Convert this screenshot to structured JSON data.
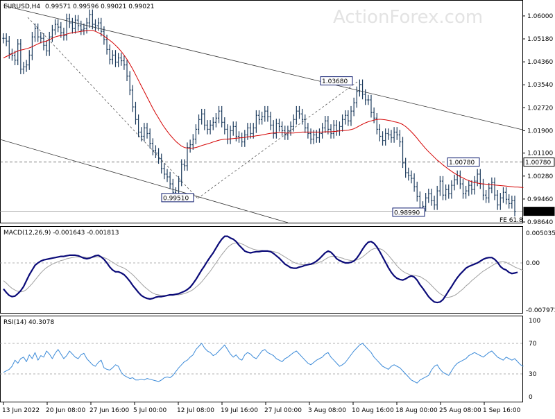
{
  "chart_data": [
    {
      "panel": "price",
      "type": "candlestick",
      "title": "EURUSD,H4",
      "ohlc_header": "0.99571 0.99596 0.99021 0.99021",
      "watermark": "ActionForex.com",
      "ylim": [
        0.9864,
        1.0642
      ],
      "yticks": [
        "1.06000",
        "1.05180",
        "1.04360",
        "1.03540",
        "1.02720",
        "1.01900",
        "1.01100",
        "1.00280",
        "0.99460",
        "0.98640"
      ],
      "price_tags": [
        {
          "label": "1.00780",
          "value": 1.0078
        },
        {
          "label": "0.99021",
          "value": 0.99021
        }
      ],
      "annotations": [
        {
          "text": "1.03680",
          "x": "10 Aug 2022 00:00",
          "y": 1.0368
        },
        {
          "text": "1.00780",
          "x": "26 Aug 2022 12:00",
          "y": 1.0078
        },
        {
          "text": "0.99510",
          "x": "14 Jul 2022 08:00",
          "y": 0.9951
        },
        {
          "text": "0.98990",
          "x": "23 Aug 2022 08:00",
          "y": 0.9899
        },
        {
          "text": "FE 61.8",
          "x": "5 Sep 2022 12:00",
          "y": 0.9872
        }
      ],
      "close": [
        1.052,
        1.051,
        1.0465,
        1.0458,
        1.0442,
        1.05,
        1.041,
        1.0418,
        1.0425,
        1.046,
        1.0525,
        1.0555,
        1.0525,
        1.052,
        1.0495,
        1.0475,
        1.0525,
        1.055,
        1.057,
        1.056,
        1.054,
        1.053,
        1.059,
        1.0575,
        1.0555,
        1.0585,
        1.0565,
        1.055,
        1.0555,
        1.0575,
        1.0605,
        1.057,
        1.0565,
        1.0575,
        1.0545,
        1.0515,
        1.048,
        1.0445,
        1.046,
        1.0435,
        1.045,
        1.044,
        1.0425,
        1.0385,
        1.0335,
        1.0275,
        1.023,
        1.0185,
        1.017,
        1.02,
        1.018,
        1.0145,
        1.012,
        1.011,
        1.009,
        1.0055,
        1.0035,
        1.0025,
        1.0,
        0.997,
        0.996,
        1.001,
        1.007,
        1.0065,
        1.013,
        1.014,
        1.016,
        1.0195,
        1.023,
        1.025,
        1.021,
        1.0195,
        1.021,
        1.022,
        1.0235,
        1.026,
        1.022,
        1.0195,
        1.016,
        1.019,
        1.0205,
        1.017,
        1.0165,
        1.015,
        1.0175,
        1.02,
        1.018,
        1.02,
        1.0245,
        1.023,
        1.024,
        1.026,
        1.024,
        1.021,
        1.018,
        1.0215,
        1.0205,
        1.019,
        1.0175,
        1.019,
        1.0205,
        1.023,
        1.026,
        1.025,
        1.023,
        1.02,
        1.018,
        1.016,
        1.0175,
        1.0165,
        1.018,
        1.02,
        1.0225,
        1.0195,
        1.018,
        1.021,
        1.019,
        1.0205,
        1.023,
        1.0245,
        1.0225,
        1.026,
        1.029,
        1.033,
        1.0355,
        1.032,
        1.03,
        1.03,
        1.0255,
        1.0235,
        1.0195,
        1.017,
        1.0155,
        1.018,
        1.0175,
        1.0165,
        1.0185,
        1.0175,
        1.015,
        1.0075,
        1.004,
        1.003,
        1.002,
        0.999,
        0.9955,
        0.991,
        0.992,
        0.995,
        0.9965,
        0.994,
        0.9925,
        0.9975,
        1.001,
        0.996,
        0.998,
        0.9965,
        0.9995,
        1.0015,
        1.003,
        1.0,
        0.9965,
        0.9975,
        0.9995,
        0.998,
        1.001,
        1.0035,
        1.0,
        0.996,
        0.995,
        0.9985,
        1.0005,
        0.996,
        0.9925,
        0.995,
        0.997,
        0.9945,
        0.993,
        0.994,
        0.9902
      ],
      "ma": [
        1.045,
        1.0455,
        1.046,
        1.0465,
        1.047,
        1.0475,
        1.0478,
        1.048,
        1.0483,
        1.0486,
        1.049,
        1.0495,
        1.05,
        1.0505,
        1.0508,
        1.051,
        1.0515,
        1.052,
        1.0525,
        1.0528,
        1.053,
        1.0532,
        1.0535,
        1.0538,
        1.054,
        1.0542,
        1.0543,
        1.0545,
        1.0546,
        1.0547,
        1.0548,
        1.0548,
        1.0545,
        1.054,
        1.0535,
        1.0528,
        1.052,
        1.0513,
        1.0505,
        1.0495,
        1.0485,
        1.0473,
        1.046,
        1.0445,
        1.0428,
        1.041,
        1.039,
        1.037,
        1.035,
        1.033,
        1.031,
        1.029,
        1.027,
        1.0252,
        1.0235,
        1.0218,
        1.0202,
        1.0188,
        1.0175,
        1.0163,
        1.0152,
        1.0143,
        1.0135,
        1.013,
        1.0128,
        1.0127,
        1.0128,
        1.013,
        1.0133,
        1.0137,
        1.014,
        1.0143,
        1.0146,
        1.015,
        1.0153,
        1.0156,
        1.0158,
        1.016,
        1.016,
        1.0161,
        1.0162,
        1.0163,
        1.0164,
        1.0165,
        1.0166,
        1.0168,
        1.0169,
        1.017,
        1.0172,
        1.0173,
        1.0175,
        1.0177,
        1.0179,
        1.0181,
        1.0182,
        1.0183,
        1.0183,
        1.0183,
        1.0182,
        1.0182,
        1.0182,
        1.0182,
        1.0183,
        1.0184,
        1.0185,
        1.0185,
        1.0185,
        1.0185,
        1.0185,
        1.0185,
        1.0185,
        1.0185,
        1.0186,
        1.0186,
        1.0186,
        1.0187,
        1.0188,
        1.0189,
        1.019,
        1.0191,
        1.0192,
        1.0194,
        1.0197,
        1.0202,
        1.0208,
        1.0213,
        1.0218,
        1.0222,
        1.0225,
        1.0228,
        1.023,
        1.0231,
        1.023,
        1.0229,
        1.0227,
        1.0225,
        1.0222,
        1.022,
        1.0217,
        1.0212,
        1.0205,
        1.0196,
        1.0186,
        1.0175,
        1.0163,
        1.015,
        1.0138,
        1.0126,
        1.0115,
        1.0105,
        1.0095,
        1.0085,
        1.0077,
        1.0068,
        1.006,
        1.0052,
        1.0045,
        1.0038,
        1.0032,
        1.0026,
        1.0021,
        1.0016,
        1.0012,
        1.0008,
        1.0005,
        1.0003,
        1.0001,
        1.0,
        0.9999,
        0.9998,
        0.9997,
        0.9996,
        0.9995,
        0.9994,
        0.9993,
        0.9992,
        0.9991,
        0.999,
        0.9989,
        0.9989,
        0.9988,
        0.9987
      ]
    },
    {
      "panel": "macd",
      "type": "line",
      "title": "MACD(12,26,9) -0.001643 -0.001813",
      "ylim": [
        -0.007973,
        0.005035
      ],
      "yticks": [
        "0.005035",
        "0.00",
        "-0.007973"
      ],
      "series": [
        {
          "values": [
            -0.0044,
            -0.005,
            -0.0055,
            -0.0057,
            -0.0056,
            -0.0052,
            -0.0047,
            -0.004,
            -0.003,
            -0.002,
            -0.0012,
            -0.0004,
            0.0,
            0.0003,
            0.0005,
            0.0006,
            0.0007,
            0.0008,
            0.0009,
            0.001,
            0.0011,
            0.0011,
            0.0012,
            0.0013,
            0.0013,
            0.0013,
            0.0012,
            0.001,
            0.0008,
            0.0007,
            0.0008,
            0.001,
            0.0012,
            0.0013,
            0.001,
            0.0006,
            0.0,
            -0.0007,
            -0.0012,
            -0.0015,
            -0.0015,
            -0.0017,
            -0.002,
            -0.0025,
            -0.0031,
            -0.0038,
            -0.0044,
            -0.005,
            -0.0055,
            -0.0058,
            -0.006,
            -0.0061,
            -0.006,
            -0.0058,
            -0.0057,
            -0.0057,
            -0.0056,
            -0.0055,
            -0.0054,
            -0.0054,
            -0.0053,
            -0.0052,
            -0.005,
            -0.0048,
            -0.0045,
            -0.0041,
            -0.0035,
            -0.0028,
            -0.002,
            -0.0012,
            -0.0005,
            0.0003,
            0.001,
            0.0017,
            0.0025,
            0.0033,
            0.004,
            0.0045,
            0.0045,
            0.0042,
            0.004,
            0.0036,
            0.003,
            0.0025,
            0.002,
            0.0018,
            0.0017,
            0.0018,
            0.0019,
            0.0019,
            0.002,
            0.002,
            0.002,
            0.0019,
            0.0016,
            0.0012,
            0.0008,
            0.0003,
            -0.0002,
            -0.0005,
            -0.0008,
            -0.0009,
            -0.0009,
            -0.0007,
            -0.0006,
            -0.0004,
            -0.0003,
            -0.0002,
            0.0,
            0.0003,
            0.0007,
            0.0012,
            0.0017,
            0.002,
            0.0018,
            0.0013,
            0.0007,
            0.0004,
            0.0002,
            0.0,
            0.0,
            0.0001,
            0.0003,
            0.0008,
            0.0015,
            0.0023,
            0.003,
            0.0035,
            0.0036,
            0.0033,
            0.0027,
            0.0019,
            0.001,
            0.0001,
            -0.0008,
            -0.0016,
            -0.0022,
            -0.0026,
            -0.0028,
            -0.0029,
            -0.0027,
            -0.0024,
            -0.0022,
            -0.0024,
            -0.0029,
            -0.0037,
            -0.0043,
            -0.005,
            -0.0057,
            -0.0062,
            -0.0066,
            -0.0067,
            -0.0066,
            -0.0062,
            -0.0055,
            -0.0047,
            -0.004,
            -0.0032,
            -0.0025,
            -0.0019,
            -0.0014,
            -0.0009,
            -0.0006,
            -0.0004,
            -0.0002,
            0.0,
            0.0003,
            0.0006,
            0.0008,
            0.0009,
            0.0009,
            0.0006,
            0.0001,
            -0.0006,
            -0.001,
            -0.0012,
            -0.0016,
            -0.0018,
            -0.0017,
            -0.0016
          ]
        },
        {
          "values": [
            -0.003,
            -0.0034,
            -0.0039,
            -0.0043,
            -0.0046,
            -0.0048,
            -0.0049,
            -0.0048,
            -0.0045,
            -0.004,
            -0.0035,
            -0.0029,
            -0.0023,
            -0.0017,
            -0.0012,
            -0.0008,
            -0.0005,
            -0.0002,
            0.0,
            0.0002,
            0.0004,
            0.0005,
            0.0007,
            0.0008,
            0.0009,
            0.001,
            0.001,
            0.001,
            0.001,
            0.0009,
            0.0009,
            0.0009,
            0.001,
            0.001,
            0.001,
            0.0009,
            0.0007,
            0.0004,
            0.0001,
            -0.0002,
            -0.0005,
            -0.0007,
            -0.0009,
            -0.0012,
            -0.0016,
            -0.002,
            -0.0025,
            -0.003,
            -0.0035,
            -0.004,
            -0.0044,
            -0.0048,
            -0.0051,
            -0.0053,
            -0.0054,
            -0.0055,
            -0.0055,
            -0.0055,
            -0.0055,
            -0.0055,
            -0.0054,
            -0.0054,
            -0.0053,
            -0.0052,
            -0.005,
            -0.0048,
            -0.0045,
            -0.0041,
            -0.0037,
            -0.0032,
            -0.0026,
            -0.002,
            -0.0014,
            -0.0007,
            0.0,
            0.0007,
            0.0014,
            0.002,
            0.0026,
            0.003,
            0.0033,
            0.0034,
            0.0034,
            0.0032,
            0.003,
            0.0027,
            0.0025,
            0.0023,
            0.0022,
            0.0021,
            0.0021,
            0.002,
            0.002,
            0.002,
            0.0019,
            0.0018,
            0.0016,
            0.0013,
            0.001,
            0.0007,
            0.0004,
            0.0001,
            -0.0001,
            -0.0002,
            -0.0003,
            -0.0003,
            -0.0003,
            -0.0003,
            -0.0002,
            -0.0001,
            0.0001,
            0.0003,
            0.0006,
            0.0009,
            0.0011,
            0.0011,
            0.0011,
            0.0009,
            0.0008,
            0.0006,
            0.0005,
            0.0004,
            0.0004,
            0.0005,
            0.0007,
            0.001,
            0.0014,
            0.0018,
            0.0022,
            0.0024,
            0.0025,
            0.0024,
            0.0022,
            0.0018,
            0.0013,
            0.0007,
            0.0001,
            -0.0005,
            -0.001,
            -0.0014,
            -0.0017,
            -0.0019,
            -0.0021,
            -0.0021,
            -0.0022,
            -0.0023,
            -0.0026,
            -0.0029,
            -0.0033,
            -0.0038,
            -0.0043,
            -0.0048,
            -0.0052,
            -0.0055,
            -0.0058,
            -0.0058,
            -0.0057,
            -0.0055,
            -0.0052,
            -0.0048,
            -0.0044,
            -0.0039,
            -0.0035,
            -0.003,
            -0.0026,
            -0.0022,
            -0.0018,
            -0.0014,
            -0.0011,
            -0.0008,
            -0.0005,
            -0.0002,
            0.0,
            0.0002,
            0.0002,
            0.0001,
            -0.0002,
            -0.0004,
            -0.0007,
            -0.0009,
            -0.0011,
            -0.0013
          ]
        }
      ]
    },
    {
      "panel": "rsi",
      "type": "line",
      "title": "RSI(14) 40.3078",
      "ylim": [
        0,
        100
      ],
      "yticks": [
        "100",
        "70",
        "30",
        "0"
      ],
      "values": [
        32,
        34,
        36,
        40,
        48,
        44,
        50,
        52,
        46,
        55,
        50,
        58,
        48,
        54,
        52,
        60,
        56,
        50,
        57,
        62,
        56,
        50,
        54,
        60,
        56,
        52,
        50,
        55,
        57,
        50,
        46,
        42,
        40,
        45,
        48,
        38,
        36,
        35,
        38,
        42,
        40,
        32,
        28,
        26,
        24,
        25,
        22,
        22,
        23,
        22,
        24,
        23,
        22,
        21,
        20,
        22,
        25,
        26,
        25,
        28,
        33,
        38,
        42,
        46,
        48,
        52,
        55,
        62,
        66,
        70,
        64,
        60,
        58,
        54,
        56,
        60,
        64,
        68,
        62,
        56,
        52,
        55,
        50,
        48,
        55,
        58,
        56,
        52,
        50,
        55,
        60,
        62,
        58,
        56,
        54,
        50,
        48,
        46,
        50,
        52,
        55,
        58,
        60,
        56,
        52,
        48,
        44,
        42,
        45,
        48,
        50,
        52,
        56,
        58,
        52,
        48,
        44,
        40,
        42,
        45,
        50,
        55,
        60,
        64,
        68,
        70,
        66,
        62,
        58,
        52,
        48,
        44,
        40,
        38,
        36,
        40,
        42,
        40,
        38,
        34,
        30,
        26,
        22,
        20,
        18,
        22,
        24,
        26,
        28,
        35,
        40,
        42,
        36,
        32,
        30,
        28,
        34,
        40,
        44,
        46,
        48,
        50,
        54,
        56,
        58,
        56,
        54,
        52,
        55,
        58,
        60,
        56,
        52,
        50,
        48,
        52,
        50,
        48,
        50,
        46,
        42,
        40
      ]
    }
  ],
  "x_axis": {
    "labels": [
      "13 Jun 2022",
      "20 Jun 08:00",
      "27 Jun 16:00",
      "5 Jul 00:00",
      "12 Jul 08:00",
      "19 Jul 16:00",
      "27 Jul 00:00",
      "3 Aug 08:00",
      "10 Aug 16:00",
      "18 Aug 00:00",
      "25 Aug 08:00",
      "1 Sep 16:00"
    ]
  },
  "colors": {
    "candle": "#1b3a5c",
    "ma": "#d40000",
    "macd": "#0a0a78",
    "signal": "#a0a0a0",
    "rsi": "#3b8ad8",
    "tag_border": "#0b1a6e",
    "level_line": "#000000"
  }
}
